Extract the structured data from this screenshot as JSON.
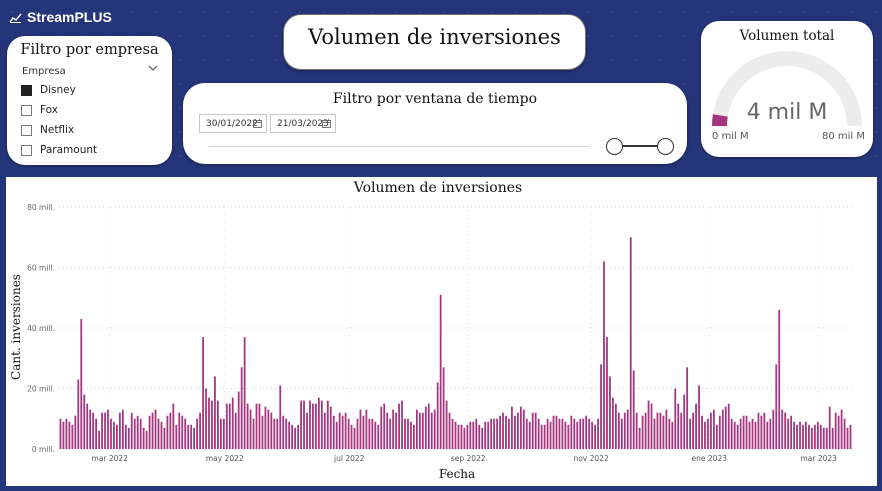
{
  "brand": {
    "name": "StreamPLUS",
    "icon": "line-chart-icon"
  },
  "company_filter": {
    "title": "Filtro por empresa",
    "field_label": "Empresa",
    "items": [
      {
        "label": "Disney",
        "checked": true
      },
      {
        "label": "Fox",
        "checked": false
      },
      {
        "label": "Netflix",
        "checked": false
      },
      {
        "label": "Paramount",
        "checked": false
      }
    ]
  },
  "page_title": "Volumen de inversiones",
  "date_filter": {
    "title": "Filtro por ventana de tiempo",
    "start": "30/01/2022",
    "end": "21/03/2023"
  },
  "gauge": {
    "title": "Volumen total",
    "value_label": "4 mil M",
    "min_label": "0 mil M",
    "max_label": "80 mil M",
    "value": 4,
    "max": 80,
    "color": "#a4357e"
  },
  "chart_data": {
    "type": "bar",
    "title": "Volumen de inversiones",
    "xlabel": "Fecha",
    "ylabel": "Cant. inversiones",
    "y_ticks": [
      "0 mill.",
      "20 mill.",
      "40 mill.",
      "60 mill.",
      "80 mill."
    ],
    "ylim": [
      0,
      80
    ],
    "x_ticks": [
      "mar 2022",
      "may 2022",
      "jul 2022",
      "sep 2022",
      "nov 2022",
      "ene 2023",
      "mar 2023"
    ],
    "color": "#a4357e",
    "grid": true,
    "values": [
      10,
      9,
      10,
      9,
      8,
      11,
      23,
      43,
      18,
      15,
      13,
      12,
      10,
      6,
      12,
      12,
      13,
      10,
      9,
      8,
      12,
      13,
      8,
      7,
      12,
      10,
      11,
      10,
      7,
      6,
      11,
      12,
      13,
      10,
      9,
      7,
      11,
      12,
      15,
      8,
      12,
      11,
      10,
      8,
      8,
      7,
      10,
      12,
      37,
      20,
      17,
      16,
      24,
      16,
      10,
      10,
      15,
      15,
      17,
      12,
      19,
      27,
      37,
      15,
      13,
      10,
      15,
      15,
      11,
      14,
      13,
      12,
      10,
      10,
      21,
      11,
      10,
      9,
      8,
      7,
      8,
      16,
      16,
      12,
      16,
      15,
      15,
      17,
      16,
      12,
      16,
      14,
      11,
      9,
      12,
      11,
      12,
      10,
      8,
      7,
      10,
      13,
      11,
      13,
      10,
      10,
      9,
      8,
      14,
      15,
      12,
      10,
      13,
      12,
      15,
      16,
      10,
      10,
      9,
      8,
      13,
      12,
      12,
      14,
      15,
      12,
      13,
      22,
      51,
      27,
      16,
      12,
      10,
      9,
      8,
      8,
      7,
      8,
      9,
      9,
      10,
      8,
      7,
      9,
      9,
      10,
      10,
      10,
      11,
      12,
      11,
      10,
      14,
      11,
      12,
      14,
      13,
      10,
      9,
      12,
      12,
      10,
      8,
      8,
      10,
      9,
      11,
      11,
      10,
      10,
      9,
      8,
      11,
      10,
      9,
      10,
      10,
      11,
      10,
      9,
      8,
      10,
      28,
      62,
      37,
      24,
      17,
      15,
      12,
      10,
      12,
      13,
      70,
      26,
      12,
      7,
      11,
      12,
      16,
      15,
      10,
      12,
      12,
      11,
      13,
      10,
      9,
      20,
      15,
      12,
      18,
      27,
      10,
      12,
      15,
      21,
      11,
      9,
      10,
      12,
      13,
      8,
      11,
      13,
      14,
      15,
      10,
      9,
      8,
      10,
      11,
      11,
      9,
      10,
      9,
      12,
      11,
      12,
      9,
      10,
      13,
      28,
      46,
      13,
      12,
      10,
      11,
      9,
      8,
      9,
      8,
      9,
      8,
      7,
      8,
      9,
      8,
      7,
      7,
      14,
      7,
      12,
      11,
      13,
      10,
      7,
      8
    ]
  }
}
